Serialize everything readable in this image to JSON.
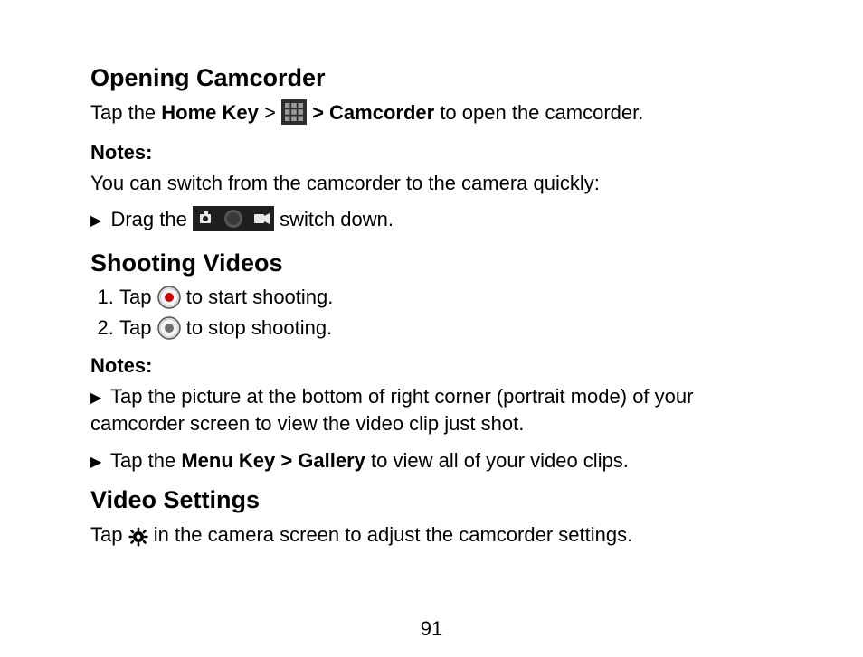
{
  "page_number": "91",
  "section1": {
    "heading": "Opening Camcorder",
    "tap_prefix": "Tap the ",
    "home_key": "Home Key",
    "gt1": " > ",
    "gt2": " > ",
    "camcorder_bold": "Camcorder",
    "open_suffix": " to open the camcorder.",
    "notes_label": "Notes:",
    "notes_intro": "You can switch from the camcorder to the camera quickly:",
    "drag_prefix": "Drag the ",
    "drag_suffix": " switch down."
  },
  "section2": {
    "heading": "Shooting Videos",
    "step1_prefix": "Tap ",
    "step1_suffix": " to start shooting.",
    "step2_prefix": "Tap ",
    "step2_suffix": " to stop shooting.",
    "notes_label": "Notes:",
    "note1": "Tap the picture at the bottom of right corner (portrait mode) of your camcorder screen to view the video clip just shot.",
    "note2_prefix": "Tap the ",
    "note2_bold": "Menu Key > Gallery",
    "note2_suffix": " to view all of your video clips."
  },
  "section3": {
    "heading": "Video Settings",
    "tap_prefix": "Tap ",
    "tap_suffix": " in the camera screen to adjust the camcorder settings."
  }
}
